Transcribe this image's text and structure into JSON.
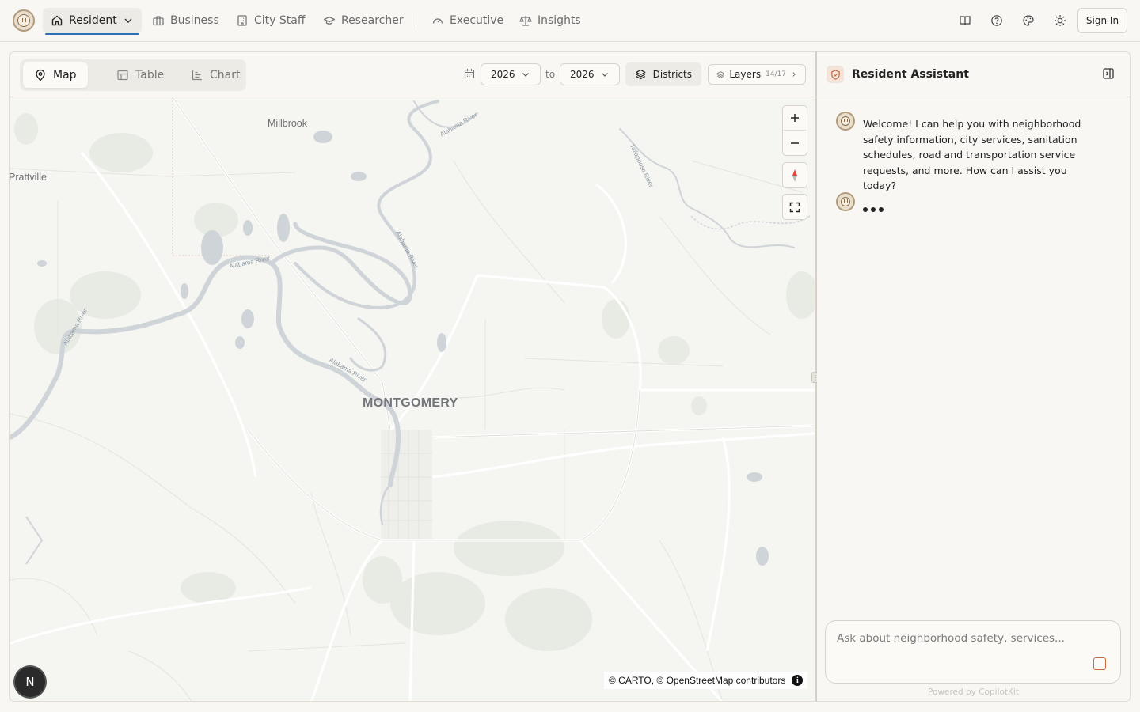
{
  "nav": {
    "items": [
      {
        "label": "Resident",
        "icon": "home-icon",
        "active": true
      },
      {
        "label": "Business",
        "icon": "briefcase-icon"
      },
      {
        "label": "City Staff",
        "icon": "building-icon"
      },
      {
        "label": "Researcher",
        "icon": "graduation-cap-icon"
      },
      {
        "label": "Executive",
        "icon": "gauge-icon"
      },
      {
        "label": "Insights",
        "icon": "scale-icon"
      }
    ],
    "tools": [
      "book-icon",
      "help-icon",
      "palette-icon",
      "sun-icon"
    ],
    "signin_label": "Sign In"
  },
  "view_tabs": [
    {
      "label": "Map",
      "icon": "map-pin-icon",
      "active": true
    },
    {
      "label": "Table",
      "icon": "table-icon"
    },
    {
      "label": "Chart",
      "icon": "chart-icon"
    }
  ],
  "filters": {
    "from_year": "2026",
    "to_label": "to",
    "to_year": "2026",
    "districts_label": "Districts",
    "layers_label": "Layers",
    "layers_count": "14/17"
  },
  "map": {
    "labels": {
      "millbrook": "Millbrook",
      "prattville": "Prattville",
      "montgomery": "MONTGOMERY",
      "alabama_river": "Alabama River",
      "tallapoosa_river": "Tallapoosa River"
    },
    "attribution": "© CARTO, © OpenStreetMap contributors",
    "badge": "N",
    "colors": {
      "water": "#cfd4d8",
      "park": "#e6ebe3",
      "road": "#ffffff"
    }
  },
  "assistant": {
    "title": "Resident Assistant",
    "welcome": "Welcome! I can help you with neighborhood safety information, city services, sanitation schedules, road and transportation service requests, and more. How can I assist you today?",
    "input_placeholder": "Ask about neighborhood safety, services...",
    "powered_by": "Powered by CopilotKit",
    "accent": "#c86a3c"
  }
}
